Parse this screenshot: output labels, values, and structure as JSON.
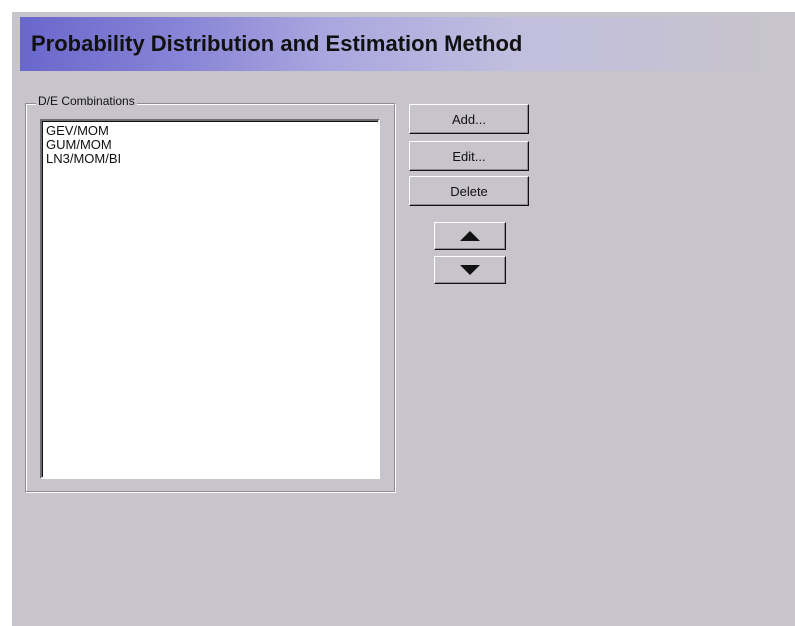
{
  "header": {
    "title": "Probability Distribution and Estimation Method"
  },
  "combinations": {
    "group_label": "D/E Combinations",
    "items": [
      {
        "label": "GEV/MOM"
      },
      {
        "label": "GUM/MOM"
      },
      {
        "label": "LN3/MOM/BI"
      }
    ]
  },
  "actions": {
    "add_label": "Add...",
    "edit_label": "Edit...",
    "delete_label": "Delete",
    "move_up_icon": "triangle-up-icon",
    "move_down_icon": "triangle-down-icon"
  },
  "colors": {
    "panel_background": "#c7c4cb",
    "banner_start": "#6a67cc",
    "banner_end": "#c7c4cb"
  }
}
